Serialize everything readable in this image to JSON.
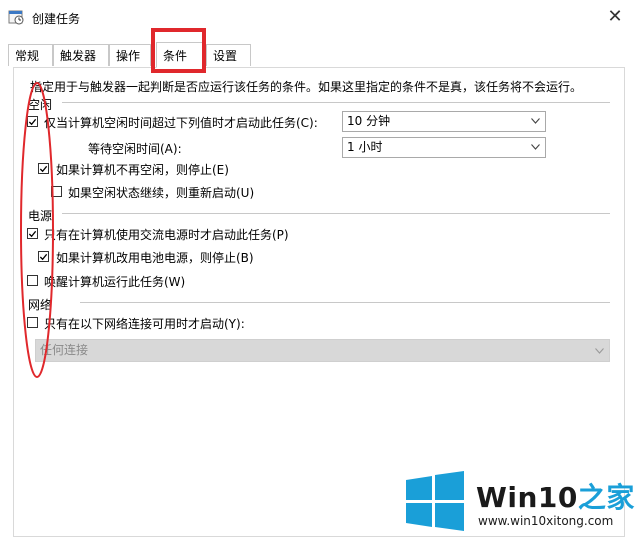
{
  "window": {
    "title": "创建任务",
    "close": "✕"
  },
  "tabs": [
    {
      "label": "常规",
      "active": false
    },
    {
      "label": "触发器",
      "active": false
    },
    {
      "label": "操作",
      "active": false
    },
    {
      "label": "条件",
      "active": true
    },
    {
      "label": "设置",
      "active": false
    }
  ],
  "description": "指定用于与触发器一起判断是否应运行该任务的条件。如果这里指定的条件不是真，该任务将不会运行。",
  "idle": {
    "group_label": "空闲",
    "start_if_idle": {
      "label": "仅当计算机空闲时间超过下列值时才启动此任务(C):",
      "checked": true,
      "value": "10 分钟"
    },
    "wait_for_idle": {
      "label": "等待空闲时间(A):",
      "value": "1 小时"
    },
    "stop_if_not_idle": {
      "label": "如果计算机不再空闲，则停止(E)",
      "checked": true
    },
    "restart_if_idle": {
      "label": "如果空闲状态继续，则重新启动(U)",
      "checked": false
    }
  },
  "power": {
    "group_label": "电源",
    "ac_only": {
      "label": "只有在计算机使用交流电源时才启动此任务(P)",
      "checked": true
    },
    "stop_on_battery": {
      "label": "如果计算机改用电池电源，则停止(B)",
      "checked": true
    },
    "wake_to_run": {
      "label": "唤醒计算机运行此任务(W)",
      "checked": false
    }
  },
  "network": {
    "group_label": "网络",
    "only_if_network": {
      "label": "只有在以下网络连接可用时才启动(Y):",
      "checked": false
    },
    "connection": {
      "value": "任何连接",
      "disabled": true
    }
  },
  "watermark": {
    "brand_latin": "Win10",
    "brand_zh": "之家",
    "url": "www.win10xitong.com"
  },
  "colors": {
    "highlight_red": "#e0282c",
    "watermark_blue": "#1a9fd8"
  }
}
